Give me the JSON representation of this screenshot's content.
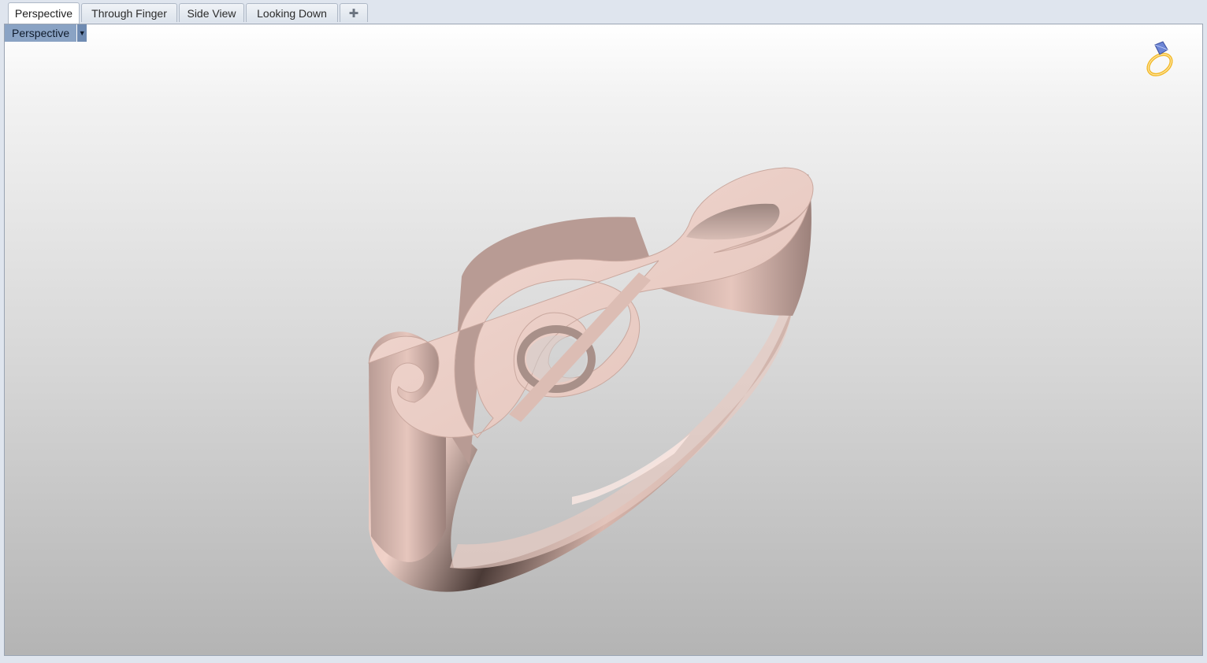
{
  "tabs": [
    {
      "label": "Perspective",
      "active": true
    },
    {
      "label": "Through Finger",
      "active": false
    },
    {
      "label": "Side View",
      "active": false
    },
    {
      "label": "Looking Down",
      "active": false
    }
  ],
  "add_tab_icon": "plus-icon",
  "viewport": {
    "label": "Perspective",
    "dropdown_icon": "triangle-down-icon",
    "corner_icon": "ring-logo-icon"
  },
  "model": {
    "description_icon": "treble-clef-ring",
    "metal_color": "#d9b3a8"
  }
}
